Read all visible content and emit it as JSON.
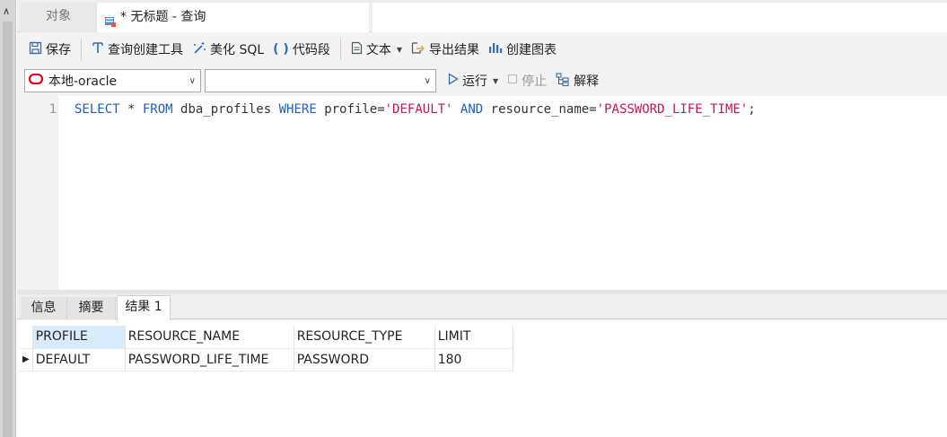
{
  "tabs": {
    "objects_label": "对象",
    "query_label": "* 无标题 - 查询"
  },
  "toolbar": {
    "save_label": "保存",
    "query_builder_label": "查询创建工具",
    "beautify_label": "美化 SQL",
    "snippet_label": "代码段",
    "text_label": "文本",
    "export_label": "导出结果",
    "chart_label": "创建图表"
  },
  "connection": {
    "selected": "本地-oracle",
    "database_selected": ""
  },
  "run": {
    "run_label": "运行",
    "stop_label": "停止",
    "explain_label": "解释"
  },
  "editor": {
    "line_number": "1",
    "tokens": [
      {
        "t": "SELECT",
        "c": "kw"
      },
      {
        "t": " * ",
        "c": "plain"
      },
      {
        "t": "FROM",
        "c": "kw"
      },
      {
        "t": " dba_profiles ",
        "c": "plain"
      },
      {
        "t": "WHERE",
        "c": "kw"
      },
      {
        "t": " profile=",
        "c": "plain"
      },
      {
        "t": "'DEFAULT'",
        "c": "str"
      },
      {
        "t": " ",
        "c": "plain"
      },
      {
        "t": "AND",
        "c": "kw"
      },
      {
        "t": " resource_name=",
        "c": "plain"
      },
      {
        "t": "'PASSWORD_LIFE_TIME'",
        "c": "str"
      },
      {
        "t": ";",
        "c": "plain"
      }
    ]
  },
  "result_tabs": {
    "info_label": "信息",
    "summary_label": "摘要",
    "result_label": "结果 1"
  },
  "grid": {
    "columns": [
      "PROFILE",
      "RESOURCE_NAME",
      "RESOURCE_TYPE",
      "LIMIT"
    ],
    "rows": [
      [
        "DEFAULT",
        "PASSWORD_LIFE_TIME",
        "PASSWORD",
        "180"
      ]
    ]
  },
  "colors": {
    "keyword": "#1f5fbf",
    "string": "#c2185b",
    "oracle_red": "#e0001b",
    "selected_header": "#d9ebfb"
  }
}
